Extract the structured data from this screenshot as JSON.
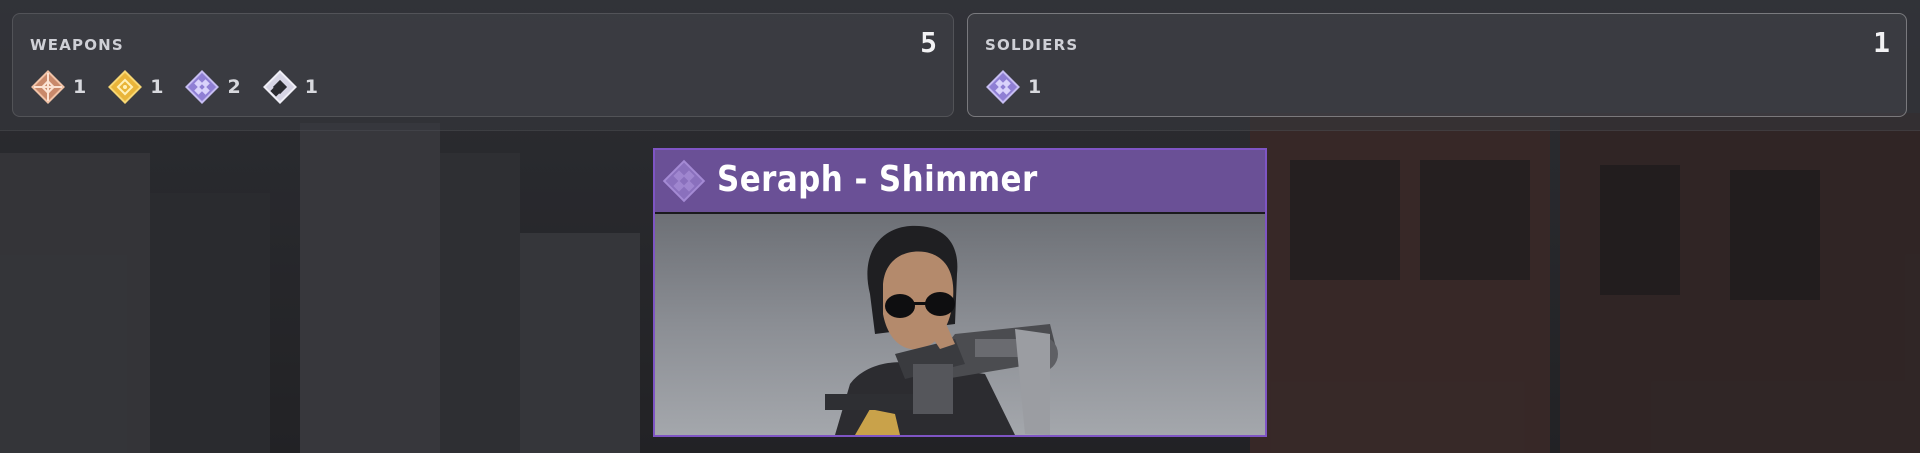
{
  "weapons": {
    "title": "WEAPONS",
    "total": "5",
    "rarities": [
      {
        "icon": "rarity-common-icon",
        "color": "#e8a27c",
        "count": "1"
      },
      {
        "icon": "rarity-rare-icon",
        "color": "#f0c040",
        "count": "1"
      },
      {
        "icon": "rarity-epic-icon",
        "color": "#a89be6",
        "count": "2"
      },
      {
        "icon": "rarity-dark-icon",
        "color": "#c6c4d8",
        "count": "1"
      }
    ]
  },
  "soldiers": {
    "title": "SOLDIERS",
    "total": "1",
    "rarities": [
      {
        "icon": "rarity-epic-icon",
        "color": "#a89be6",
        "count": "1"
      }
    ]
  },
  "card": {
    "title": "Seraph - Shimmer",
    "emblem_icon": "rarity-epic-icon",
    "header_color": "#6a5096",
    "border_color": "#7f55c4"
  }
}
